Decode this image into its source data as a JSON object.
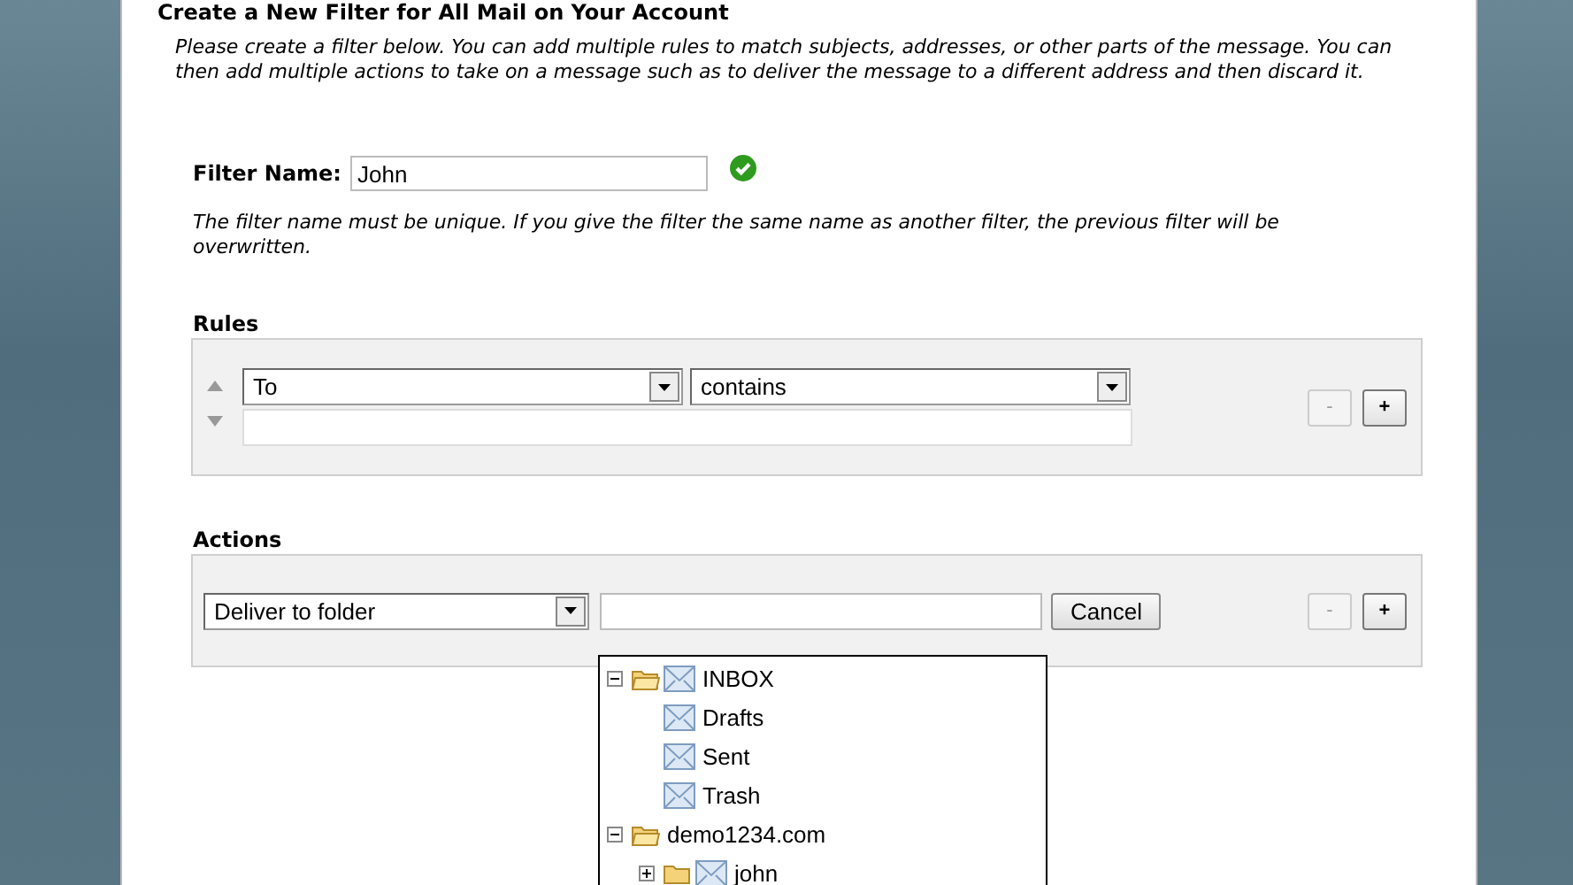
{
  "page_title": "Create a New Filter for All Mail on Your Account",
  "intro": "Please create a filter below. You can add multiple rules to match subjects, addresses, or other parts of the message. You can then add multiple actions to take on a message such as to deliver the message to a different address and then discard it.",
  "filter_name": {
    "label": "Filter Name:",
    "value": "John",
    "valid": true
  },
  "filter_hint": "The filter name must be unique. If you give the filter the same name as another filter, the previous filter will be overwritten.",
  "rules": {
    "heading": "Rules",
    "field": "To",
    "operator": "contains",
    "buttons": [
      {
        "label": "-",
        "disabled": true
      },
      {
        "label": "+",
        "disabled": false
      }
    ]
  },
  "actions": {
    "heading": "Actions",
    "action": "Deliver to folder",
    "cancel": "Cancel",
    "buttons": [
      {
        "label": "-",
        "disabled": true
      },
      {
        "label": "+",
        "disabled": false
      }
    ]
  },
  "folder_tree": [
    {
      "label": "INBOX",
      "kind": "folder-mail",
      "expanded": true,
      "children": [
        {
          "label": "Drafts",
          "kind": "mail"
        },
        {
          "label": "Sent",
          "kind": "mail"
        },
        {
          "label": "Trash",
          "kind": "mail"
        }
      ]
    },
    {
      "label": "demo1234.com",
      "kind": "folder",
      "expanded": true,
      "children": [
        {
          "label": "john",
          "kind": "folder-mail",
          "expanded": false
        }
      ]
    }
  ]
}
